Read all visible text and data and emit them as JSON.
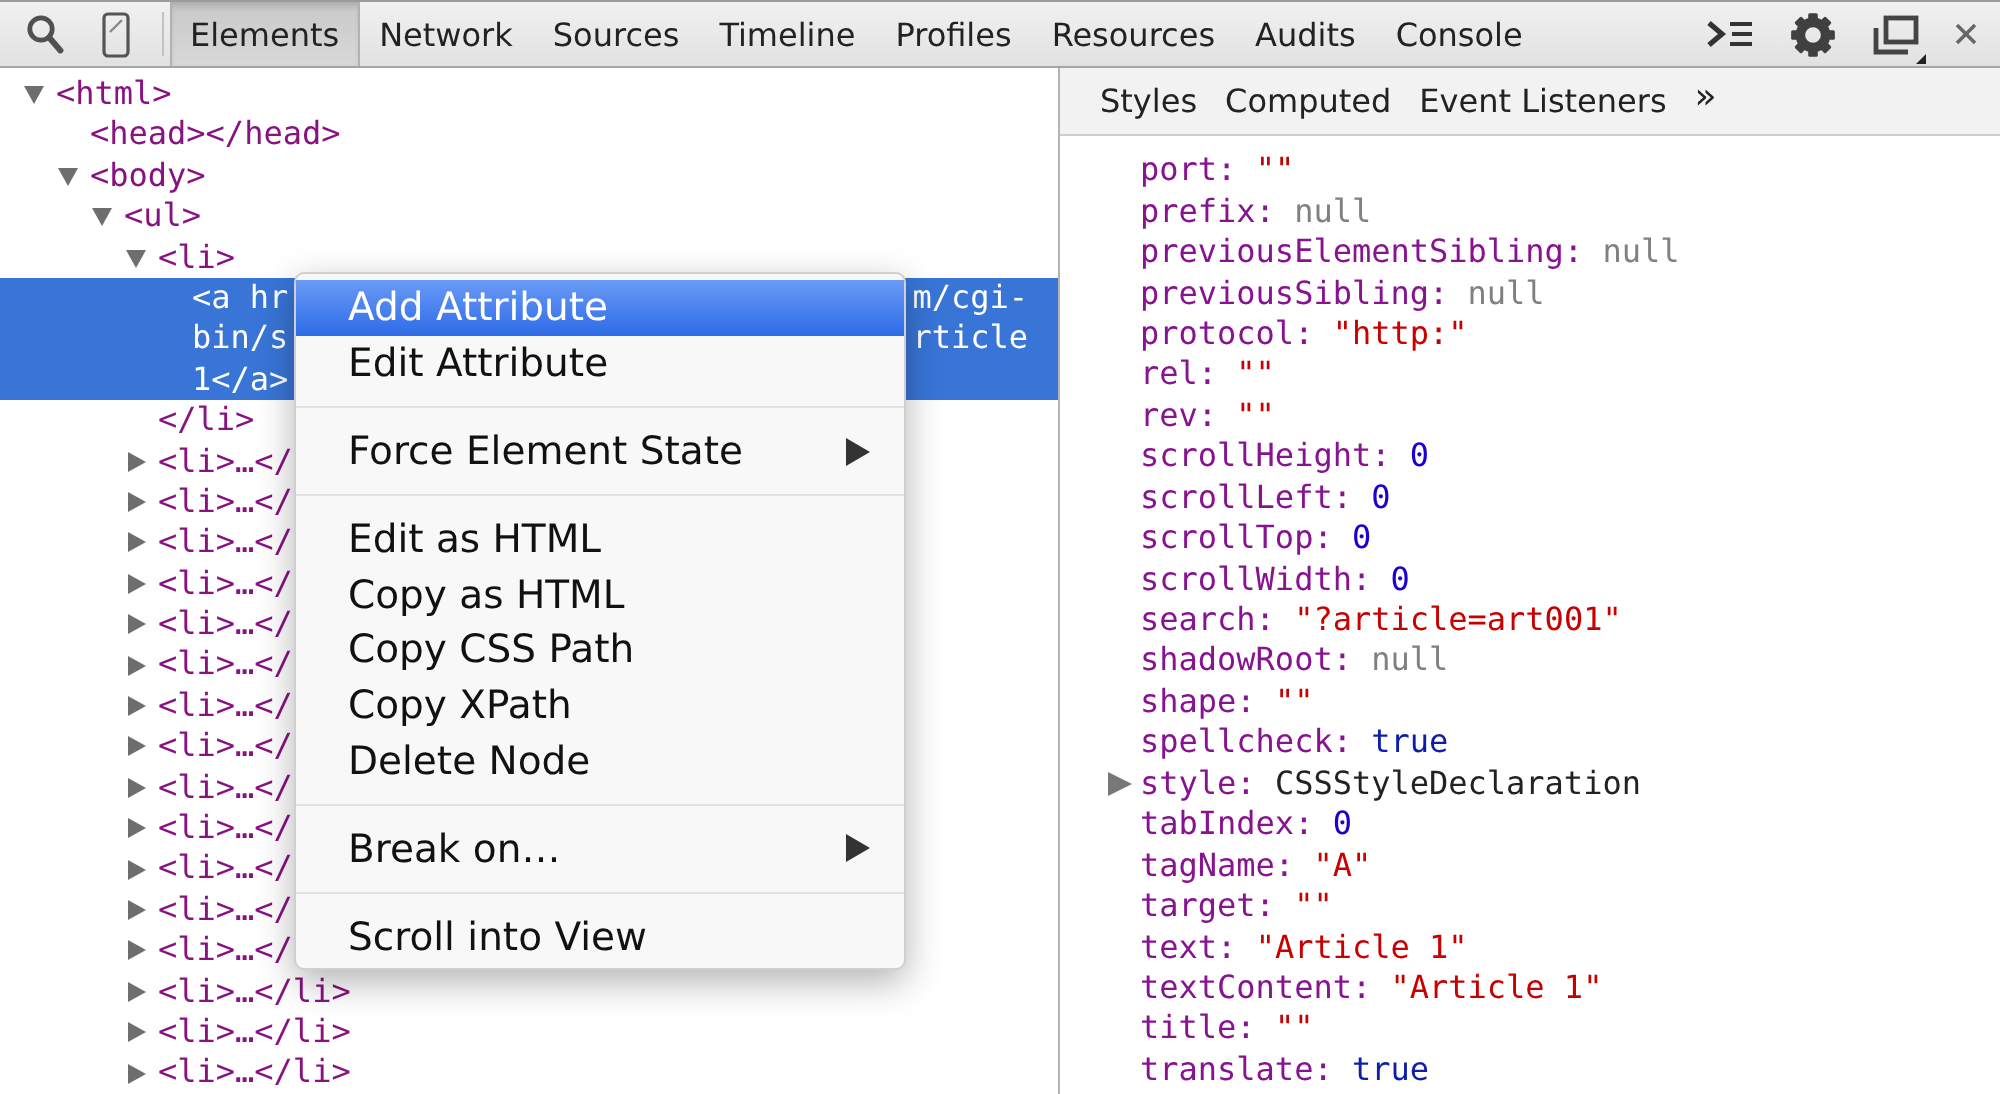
{
  "toolbar": {
    "tabs": [
      {
        "label": "Elements",
        "selected": true
      },
      {
        "label": "Network",
        "selected": false
      },
      {
        "label": "Sources",
        "selected": false
      },
      {
        "label": "Timeline",
        "selected": false
      },
      {
        "label": "Profiles",
        "selected": false
      },
      {
        "label": "Resources",
        "selected": false
      },
      {
        "label": "Audits",
        "selected": false
      },
      {
        "label": "Console",
        "selected": false
      }
    ]
  },
  "dom_tree": [
    {
      "text": "<html>",
      "expanded": true,
      "selected": false,
      "children": [
        {
          "text": "<head></head>",
          "selected": false
        },
        {
          "text": "<body>",
          "expanded": true,
          "selected": false,
          "children": [
            {
              "text": "<ul>",
              "expanded": true,
              "selected": false,
              "children": [
                {
                  "text": "<li>",
                  "expanded": true,
                  "selected": false,
                  "closing": "</li>",
                  "children": [
                    {
                      "lines": [
                        {
                          "start": "<a hr",
                          "end": "m/cgi-"
                        },
                        {
                          "start": "bin/s",
                          "end": "rticle"
                        },
                        {
                          "start": "1</a>"
                        }
                      ],
                      "selected": true
                    }
                  ]
                },
                {
                  "text": "<li>…</",
                  "expanded": false,
                  "selected": false
                },
                {
                  "text": "<li>…</",
                  "expanded": false,
                  "selected": false
                },
                {
                  "text": "<li>…</",
                  "expanded": false,
                  "selected": false
                },
                {
                  "text": "<li>…</",
                  "expanded": false,
                  "selected": false
                },
                {
                  "text": "<li>…</",
                  "expanded": false,
                  "selected": false
                },
                {
                  "text": "<li>…</",
                  "expanded": false,
                  "selected": false
                },
                {
                  "text": "<li>…</",
                  "expanded": false,
                  "selected": false
                },
                {
                  "text": "<li>…</",
                  "expanded": false,
                  "selected": false
                },
                {
                  "text": "<li>…</",
                  "expanded": false,
                  "selected": false
                },
                {
                  "text": "<li>…</",
                  "expanded": false,
                  "selected": false
                },
                {
                  "text": "<li>…</",
                  "expanded": false,
                  "selected": false
                },
                {
                  "text": "<li>…</",
                  "expanded": false,
                  "selected": false
                },
                {
                  "text": "<li>…</",
                  "expanded": false,
                  "selected": false
                },
                {
                  "text": "<li>…</li>",
                  "expanded": false,
                  "selected": false
                },
                {
                  "text": "<li>…</li>",
                  "expanded": false,
                  "selected": false
                },
                {
                  "text": "<li>…</li>",
                  "expanded": false,
                  "selected": false
                }
              ]
            }
          ]
        }
      ]
    }
  ],
  "context_menu": {
    "items": [
      {
        "kind": "item",
        "label": "Add Attribute",
        "selected": true,
        "submenu": false
      },
      {
        "kind": "item",
        "label": "Edit Attribute",
        "selected": false,
        "submenu": false
      },
      {
        "kind": "separator"
      },
      {
        "kind": "item",
        "label": "Force Element State",
        "selected": false,
        "submenu": true
      },
      {
        "kind": "separator"
      },
      {
        "kind": "item",
        "label": "Edit as HTML",
        "selected": false,
        "submenu": false
      },
      {
        "kind": "item",
        "label": "Copy as HTML",
        "selected": false,
        "submenu": false
      },
      {
        "kind": "item",
        "label": "Copy CSS Path",
        "selected": false,
        "submenu": false
      },
      {
        "kind": "item",
        "label": "Copy XPath",
        "selected": false,
        "submenu": false
      },
      {
        "kind": "item",
        "label": "Delete Node",
        "selected": false,
        "submenu": false
      },
      {
        "kind": "separator"
      },
      {
        "kind": "item",
        "label": "Break on…",
        "selected": false,
        "submenu": true
      },
      {
        "kind": "separator"
      },
      {
        "kind": "item",
        "label": "Scroll into View",
        "selected": false,
        "submenu": false
      }
    ]
  },
  "sidebar": {
    "tabs": [
      {
        "label": "Styles"
      },
      {
        "label": "Computed"
      },
      {
        "label": "Event Listeners"
      }
    ],
    "overflow": "»",
    "properties": [
      {
        "name": "port:",
        "value": "\"\"",
        "kind": "string"
      },
      {
        "name": "prefix:",
        "value": "null",
        "kind": "null"
      },
      {
        "name": "previousElementSibling:",
        "value": "null",
        "kind": "null"
      },
      {
        "name": "previousSibling:",
        "value": "null",
        "kind": "null"
      },
      {
        "name": "protocol:",
        "value": "\"http:\"",
        "kind": "string"
      },
      {
        "name": "rel:",
        "value": "\"\"",
        "kind": "string"
      },
      {
        "name": "rev:",
        "value": "\"\"",
        "kind": "string"
      },
      {
        "name": "scrollHeight:",
        "value": "0",
        "kind": "number"
      },
      {
        "name": "scrollLeft:",
        "value": "0",
        "kind": "number"
      },
      {
        "name": "scrollTop:",
        "value": "0",
        "kind": "number"
      },
      {
        "name": "scrollWidth:",
        "value": "0",
        "kind": "number"
      },
      {
        "name": "search:",
        "value": "\"?article=art001\"",
        "kind": "string"
      },
      {
        "name": "shadowRoot:",
        "value": "null",
        "kind": "null"
      },
      {
        "name": "shape:",
        "value": "\"\"",
        "kind": "string"
      },
      {
        "name": "spellcheck:",
        "value": "true",
        "kind": "boolean"
      },
      {
        "name": "style:",
        "value": "CSSStyleDeclaration",
        "kind": "object",
        "expanded": false
      },
      {
        "name": "tabIndex:",
        "value": "0",
        "kind": "number"
      },
      {
        "name": "tagName:",
        "value": "\"A\"",
        "kind": "string"
      },
      {
        "name": "target:",
        "value": "\"\"",
        "kind": "string"
      },
      {
        "name": "text:",
        "value": "\"Article 1\"",
        "kind": "string"
      },
      {
        "name": "textContent:",
        "value": "\"Article 1\"",
        "kind": "string"
      },
      {
        "name": "title:",
        "value": "\"\"",
        "kind": "string"
      },
      {
        "name": "translate:",
        "value": "true",
        "kind": "boolean"
      }
    ]
  }
}
